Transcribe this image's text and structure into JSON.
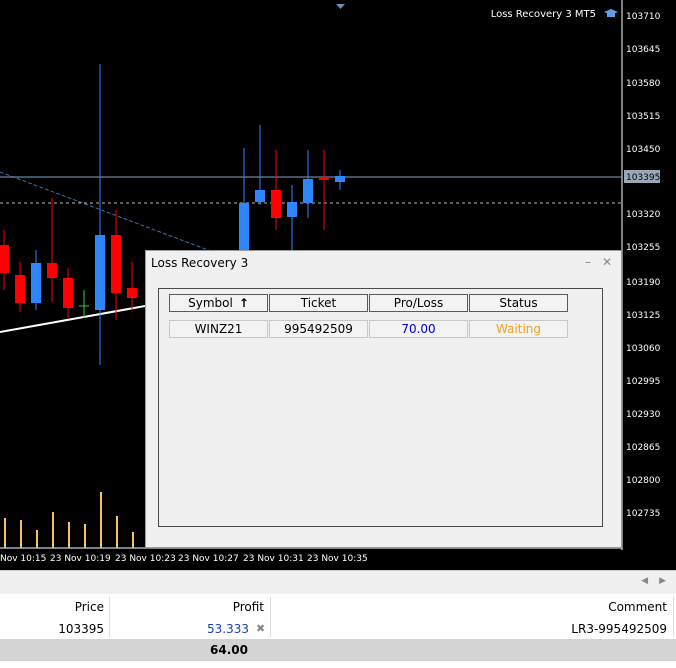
{
  "chart": {
    "title": "Loss Recovery 3 MT5",
    "current_price": "103395",
    "price_labels": [
      "103710",
      "103645",
      "103580",
      "103515",
      "103450",
      "103320",
      "103255",
      "103190",
      "103125",
      "103060",
      "102995",
      "102930",
      "102865",
      "102800",
      "102735"
    ],
    "time_labels": [
      "Nov 10:15",
      "23 Nov 10:19",
      "23 Nov 10:23",
      "23 Nov 10:27",
      "23 Nov 10:31",
      "23 Nov 10:35"
    ],
    "colors": {
      "bull": "#2e86ff",
      "bear": "#ff0000",
      "volume": "#f2c46d",
      "price_line": "#7fa3c8"
    }
  },
  "dialog": {
    "title": "Loss Recovery 3",
    "minimize_icon": "minimize-icon",
    "close_icon": "close-icon",
    "headers": [
      "Symbol",
      "Ticket",
      "Pro/Loss",
      "Status"
    ],
    "sort_icon": "arrow-up-icon",
    "row": {
      "symbol": "WINZ21",
      "ticket": "995492509",
      "profit": "70.00",
      "status": "Waiting"
    },
    "colors": {
      "profit": "#0000cc",
      "status": "#f0a020"
    }
  },
  "trades": {
    "headers": {
      "price": "Price",
      "profit": "Profit",
      "comment": "Comment"
    },
    "row": {
      "price": "103395",
      "profit": "53.333",
      "comment": "LR3-995492509"
    },
    "total": "64.00",
    "colors": {
      "profit": "#1a3fbf"
    }
  }
}
